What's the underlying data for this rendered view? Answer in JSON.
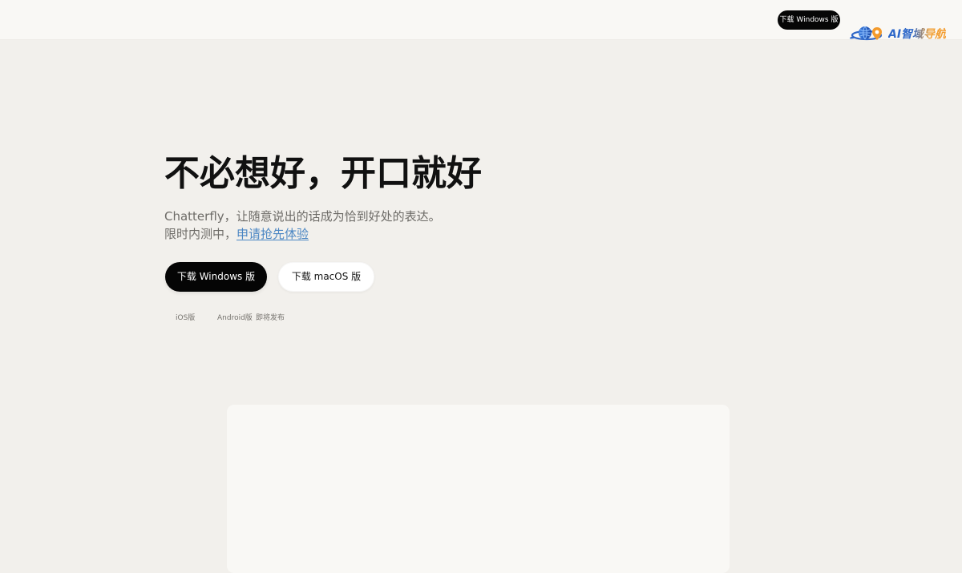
{
  "header": {
    "download_label": "下载 Windows 版"
  },
  "watermark": {
    "text": "AI智域导航",
    "colors": {
      "blue": "#2d67c9",
      "orange": "#f39a2b"
    },
    "icon": "globe-pin-icon"
  },
  "hero": {
    "title": "不必想好，开口就好",
    "description": "Chatterfly，让随意说出的话成为恰到好处的表达。",
    "beta_prefix": "限时内测中，",
    "beta_link": "申请抢先体验"
  },
  "buttons": {
    "windows": "下载 Windows 版",
    "macos": "下载 macOS 版"
  },
  "platforms": {
    "ios": "iOS版",
    "android": "Android版",
    "coming_soon": "即将发布"
  },
  "theme": {
    "page_background": "#f2f0ec",
    "header_background": "#f9f8f5",
    "primary_button": "#050505",
    "secondary_button": "#ffffff",
    "link_color": "#4b86c3",
    "muted_text": "#6d6b67"
  }
}
